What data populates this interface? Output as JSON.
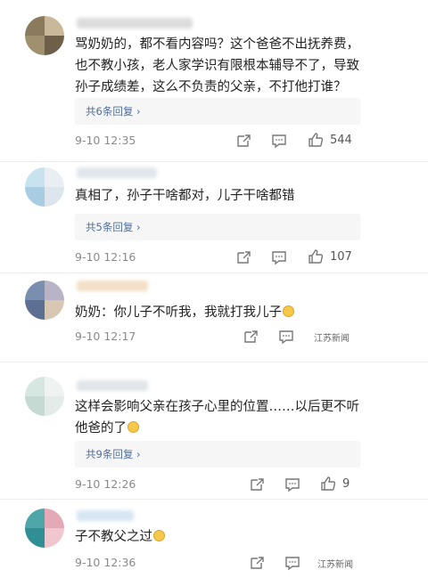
{
  "comments": [
    {
      "text": "骂奶奶的，都不看内容吗？这个爸爸不出抚养费，也不教小孩，老人家学识有限根本辅导不了，导致孙子成绩差，这么不负责的父亲，不打他打谁？",
      "reply_label": "共6条回复 ›",
      "time": "9-10 12:35",
      "likes": "544"
    },
    {
      "text": "真相了，孙子干啥都对，儿子干啥都错",
      "reply_label": "共5条回复 ›",
      "time": "9-10 12:16",
      "likes": "107"
    },
    {
      "text": "奶奶：你儿子不听我，我就打我儿子",
      "time": "9-10 12:17",
      "likes": ""
    },
    {
      "text": "这样会影响父亲在孩子心里的位置……以后更不听他爸的了",
      "reply_label": "共9条回复 ›",
      "time": "9-10 12:26",
      "likes": "9"
    },
    {
      "text": "子不教父之过",
      "time": "9-10 12:36",
      "likes": ""
    }
  ],
  "watermark": "江苏新闻",
  "colors": {
    "link": "#4e6d9b",
    "time": "#8a8a8a",
    "reply_bg": "#f6f6f6"
  }
}
